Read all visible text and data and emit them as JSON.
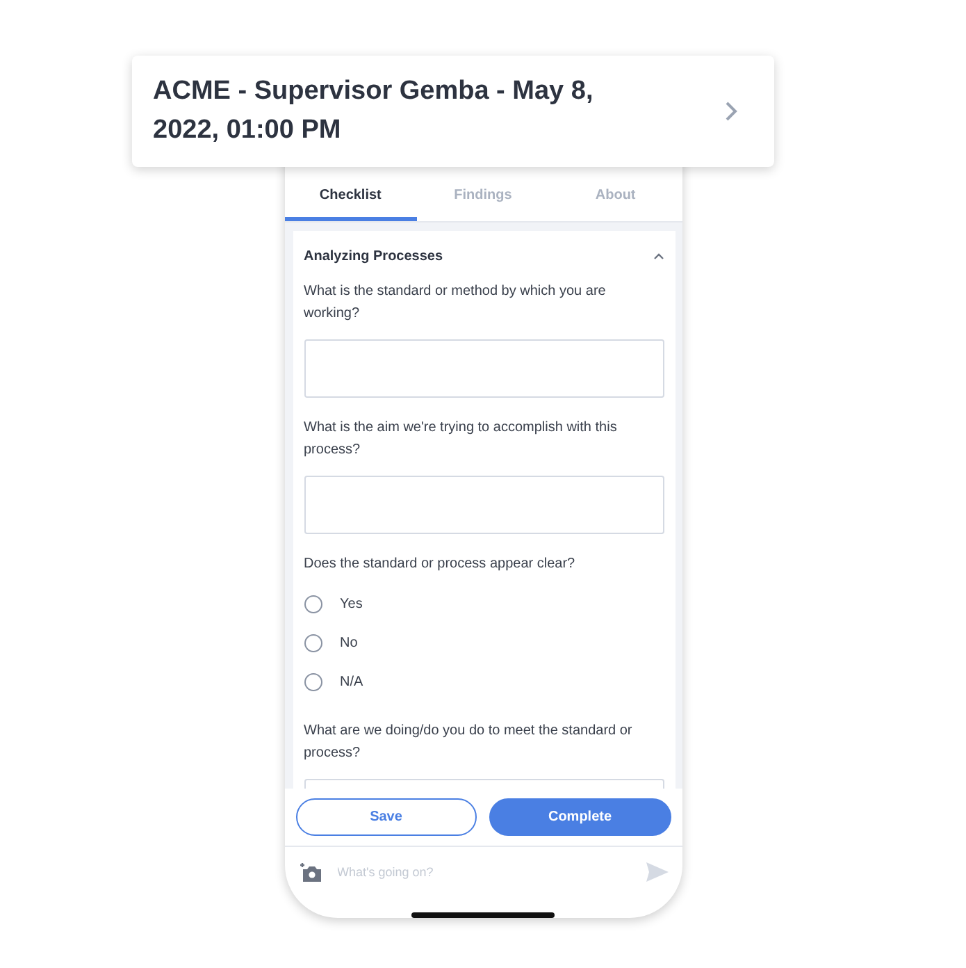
{
  "header": {
    "title": "ACME - Supervisor Gemba - May 8, 2022, 01:00 PM"
  },
  "tabs": [
    {
      "label": "Checklist",
      "selected": true
    },
    {
      "label": "Findings",
      "selected": false
    },
    {
      "label": "About",
      "selected": false
    }
  ],
  "section": {
    "title": "Analyzing Processes",
    "expanded": true,
    "questions": [
      {
        "kind": "text",
        "prompt": "What is the standard or method by which you are working?"
      },
      {
        "kind": "text",
        "prompt": "What is the aim we're trying to accomplish with this process?"
      },
      {
        "kind": "radio",
        "prompt": "Does the standard or process appear clear?",
        "options": [
          {
            "label": "Yes",
            "selected": false
          },
          {
            "label": "No",
            "selected": false
          },
          {
            "label": "N/A",
            "selected": false
          }
        ]
      },
      {
        "kind": "text",
        "prompt": "What are we doing/do you do to meet the standard or process?"
      }
    ]
  },
  "buttons": {
    "save": "Save",
    "complete": "Complete"
  },
  "composer": {
    "placeholder": "What's going on?"
  }
}
